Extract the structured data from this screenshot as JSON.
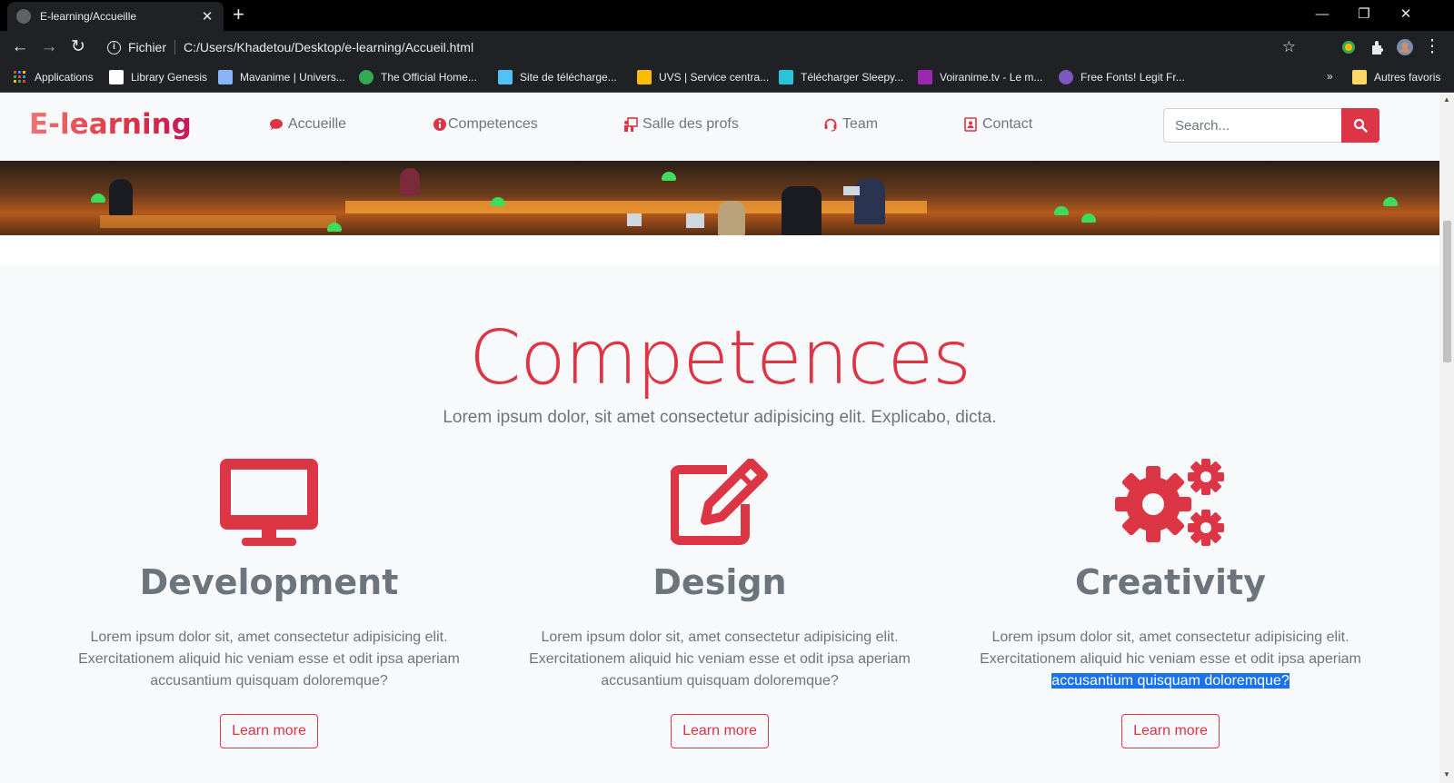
{
  "browser": {
    "tab_title": "E-learning/Accueille",
    "fichier_label": "Fichier",
    "url": "C:/Users/Khadetou/Desktop/e-learning/Accueil.html",
    "bookmarks": [
      {
        "label": "Applications",
        "color": "#4285f4"
      },
      {
        "label": "Library Genesis",
        "color": "#ffffff"
      },
      {
        "label": "Mavanime | Univers...",
        "color": "#8ab4f8"
      },
      {
        "label": "The Official Home...",
        "color": "#34a853"
      },
      {
        "label": "Site de télécharge...",
        "color": "#4fc3f7"
      },
      {
        "label": "UVS | Service centra...",
        "color": "#fbbc04"
      },
      {
        "label": "Télécharger Sleepy...",
        "color": "#26c6da"
      },
      {
        "label": "Voiranime.tv - Le m...",
        "color": "#9c27b0"
      },
      {
        "label": "Free Fonts! Legit Fr...",
        "color": "#7e57c2"
      }
    ],
    "bookmarks_more": "»",
    "other_bookmarks": "Autres favoris"
  },
  "site": {
    "brand": "E-learning",
    "nav": [
      {
        "label": "Accueille",
        "icon": "comment-icon"
      },
      {
        "label": "Competences",
        "icon": "info-circle-icon"
      },
      {
        "label": "Salle des profs",
        "icon": "chalkboard-teacher-icon"
      },
      {
        "label": "Team",
        "icon": "headset-icon"
      },
      {
        "label": "Contact",
        "icon": "address-book-icon"
      }
    ],
    "search_placeholder": "Search...",
    "accent": "#dc3545"
  },
  "competences": {
    "title": "Competences",
    "subtitle": "Lorem ipsum dolor, sit amet consectetur adipisicing elit. Explicabo, dicta.",
    "cards": [
      {
        "icon": "desktop-icon",
        "heading": "Development",
        "text_lines": [
          "Lorem ipsum dolor sit, amet consectetur adipisicing elit.",
          "Exercitationem aliquid hic veniam esse et odit ipsa aperiam",
          "accusantium quisquam doloremque?"
        ],
        "button": "Learn more"
      },
      {
        "icon": "edit-icon",
        "heading": "Design",
        "text_lines": [
          "Lorem ipsum dolor sit, amet consectetur adipisicing elit.",
          "Exercitationem aliquid hic veniam esse et odit ipsa aperiam",
          "accusantium quisquam doloremque?"
        ],
        "button": "Learn more"
      },
      {
        "icon": "cogs-icon",
        "heading": "Creativity",
        "text_lines": [
          "Lorem ipsum dolor sit, amet consectetur adipisicing elit.",
          "Exercitationem aliquid hic veniam esse et odit ipsa aperiam",
          "accusantium quisquam doloremque?"
        ],
        "button": "Learn more"
      }
    ]
  }
}
